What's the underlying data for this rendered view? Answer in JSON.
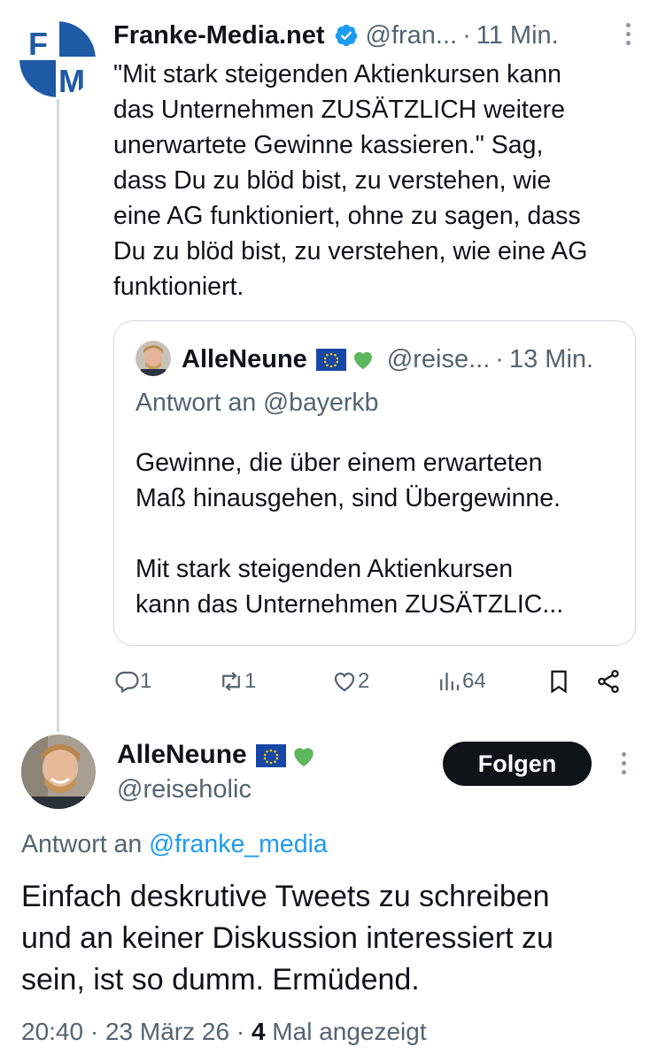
{
  "tweet": {
    "author_name": "Franke-Media.net",
    "author_handle": "@fran...",
    "separator": "·",
    "time_ago": "11 Min.",
    "avatar_letters": "FM",
    "text": "\"Mit stark steigenden Aktienkursen kann\ndas Unternehmen ZUSÄTZLICH weitere\nunerwartete Gewinne kassieren.\" Sag,\ndass Du zu blöd bist, zu verstehen, wie\neine AG funktioniert, ohne zu sagen, dass\nDu zu blöd bist, zu verstehen, wie eine AG\nfunktioniert.",
    "icons": {
      "verified": "verified-badge-icon",
      "more": "more-vertical-icon"
    }
  },
  "quote": {
    "author_name": "AlleNeune",
    "emoji": [
      "eu-flag",
      "green-heart"
    ],
    "author_handle": "@reise...",
    "separator": "·",
    "time_ago": "13 Min.",
    "reply_to": "Antwort an @bayerkb",
    "text": "Gewinne, die über einem erwarteten\nMaß hinausgehen, sind Übergewinne.\n\nMit stark steigenden Aktienkursen\nkann das Unternehmen ZUSÄTZLIC..."
  },
  "actions": {
    "replies": "1",
    "retweets": "1",
    "likes": "2",
    "views": "64",
    "icons": [
      "reply-icon",
      "retweet-icon",
      "like-icon",
      "views-icon",
      "bookmark-icon",
      "share-icon"
    ]
  },
  "reply_tweet": {
    "author_name": "AlleNeune",
    "author_handle": "@reiseholic",
    "follow_label": "Folgen",
    "reply_prefix": "Antwort an ",
    "reply_mention": "@franke_media",
    "text": "Einfach deskrutive Tweets zu schreiben\nund an keiner Diskussion interessiert zu\nsein, ist so dumm. Ermüdend.",
    "time": "20:40",
    "date": "23 März 26",
    "separator": "·",
    "view_count": "4",
    "view_label": "Mal angezeigt"
  },
  "colors": {
    "text": "#0f1419",
    "muted": "#536471",
    "link": "#1d9bf0",
    "verified": "#1d9bf0",
    "border": "#cfd9de",
    "follow_bg": "#0f1419",
    "logo_blue": "#1f5aa6"
  }
}
